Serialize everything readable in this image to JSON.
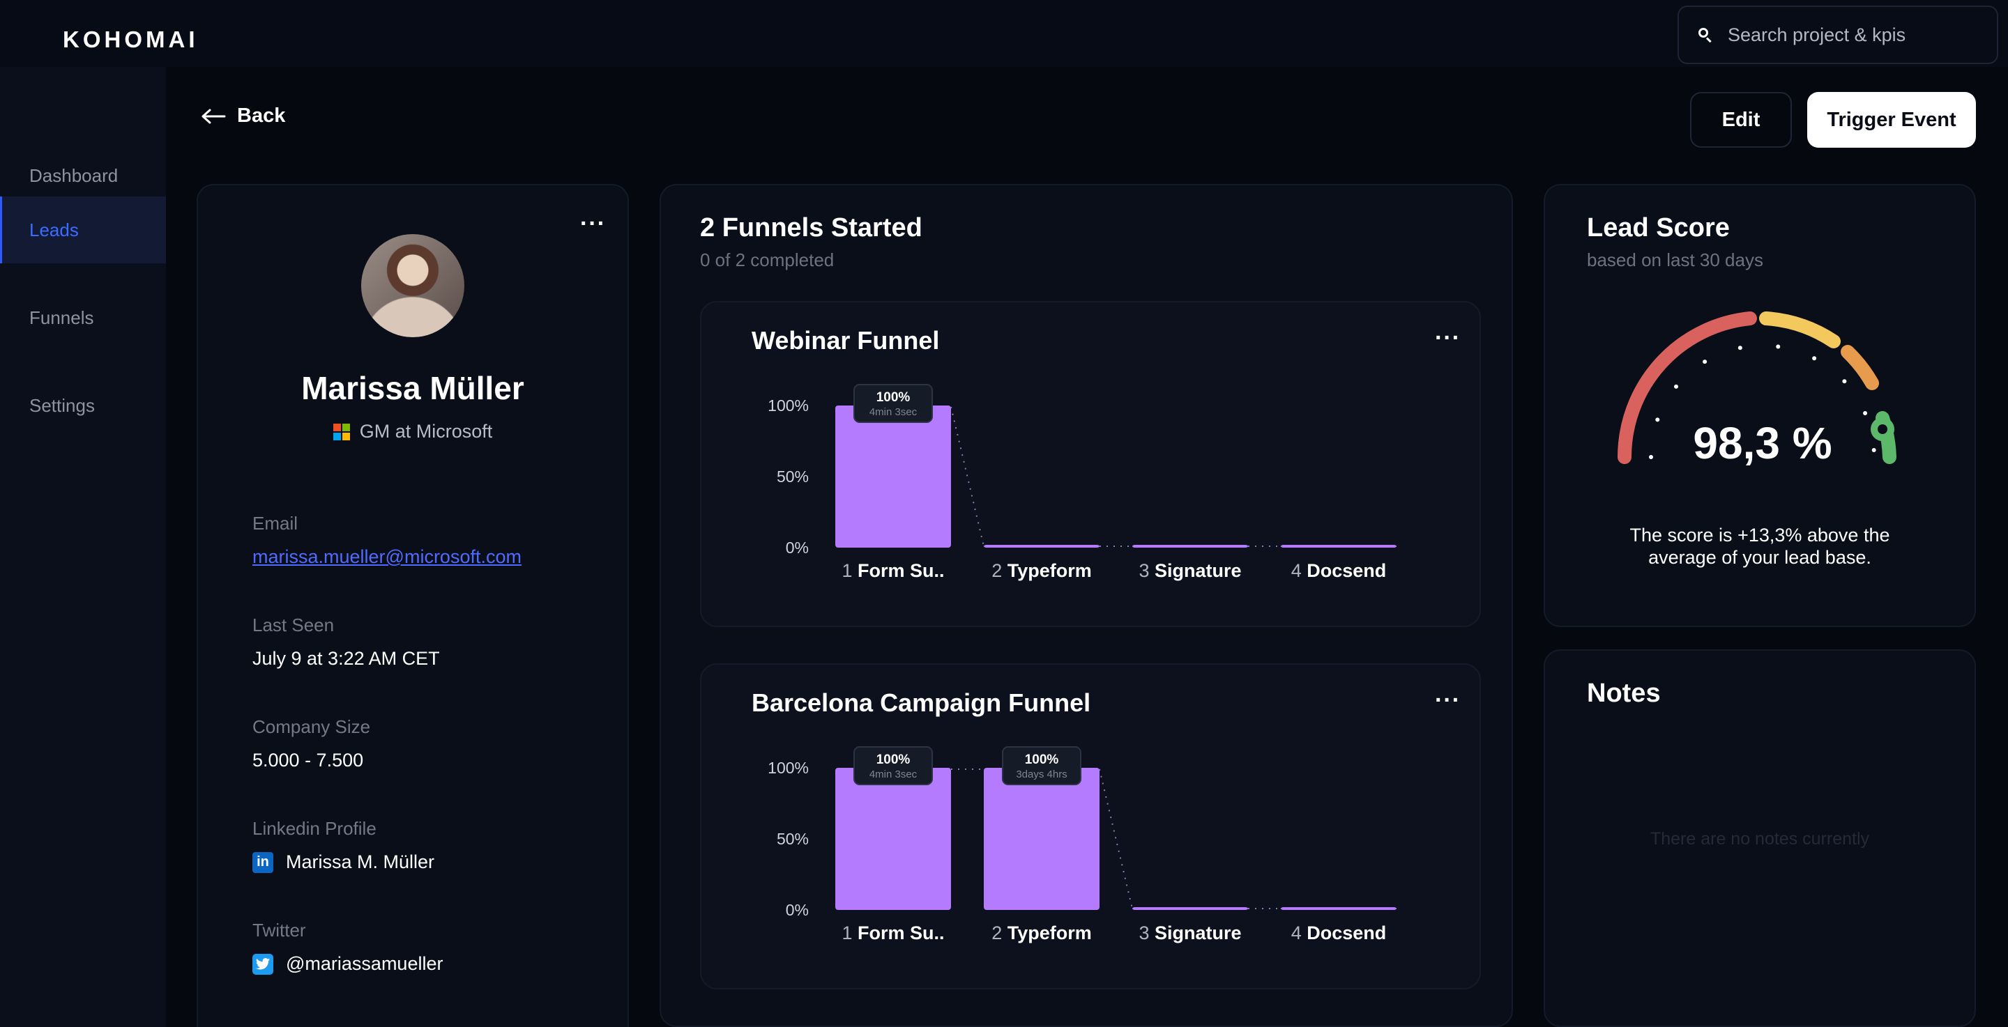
{
  "app": {
    "logo": "KOHOMAI"
  },
  "search": {
    "placeholder": "Search project & kpis",
    "icon": "search-icon"
  },
  "sidebar": {
    "items": [
      {
        "label": "Dashboard",
        "active": false
      },
      {
        "label": "Leads",
        "active": true
      },
      {
        "label": "Funnels",
        "active": false
      },
      {
        "label": "Settings",
        "active": false
      }
    ]
  },
  "header": {
    "back_label": "Back",
    "edit_label": "Edit",
    "trigger_label": "Trigger Event"
  },
  "profile": {
    "name": "Marissa Müller",
    "role": "GM at Microsoft",
    "fields": {
      "email_label": "Email",
      "email": "marissa.mueller@microsoft.com",
      "last_seen_label": "Last Seen",
      "last_seen": "July 9 at 3:22 AM CET",
      "company_size_label": "Company Size",
      "company_size": "5.000 - 7.500",
      "linkedin_label": "Linkedin Profile",
      "linkedin": "Marissa M. Müller",
      "twitter_label": "Twitter",
      "twitter": "@mariassamueller"
    }
  },
  "funnels": {
    "title": "2 Funnels Started",
    "subtitle": "0 of 2 completed"
  },
  "chart_data": [
    {
      "type": "bar",
      "title": "Webinar Funnel",
      "categories": [
        "Form Su..",
        "Typeform",
        "Signature",
        "Docsend"
      ],
      "category_numbers": [
        "1",
        "2",
        "3",
        "4"
      ],
      "values": [
        100,
        0,
        0,
        0
      ],
      "yticks": [
        "100%",
        "50%",
        "0%"
      ],
      "ylim": [
        0,
        100
      ],
      "labels": [
        {
          "index": 0,
          "value": "100%",
          "time": "4min 3sec"
        }
      ],
      "bar_color": "#b57bff"
    },
    {
      "type": "bar",
      "title": "Barcelona Campaign Funnel",
      "categories": [
        "Form Su..",
        "Typeform",
        "Signature",
        "Docsend"
      ],
      "category_numbers": [
        "1",
        "2",
        "3",
        "4"
      ],
      "values": [
        100,
        100,
        0,
        0
      ],
      "yticks": [
        "100%",
        "50%",
        "0%"
      ],
      "ylim": [
        0,
        100
      ],
      "labels": [
        {
          "index": 0,
          "value": "100%",
          "time": "4min 3sec"
        },
        {
          "index": 1,
          "value": "100%",
          "time": "3days 4hrs"
        }
      ],
      "bar_color": "#b57bff"
    }
  ],
  "lead_score": {
    "title": "Lead Score",
    "subtitle": "based on last 30 days",
    "value_text": "98,3 %",
    "value": 98.3,
    "description_line1": "The score is +13,3% above the",
    "description_line2": "average of your lead base.",
    "gauge_colors": [
      "#d9625f",
      "#f3c85c",
      "#e79b4d",
      "#5cb96a"
    ]
  },
  "notes": {
    "title": "Notes",
    "empty_text": "There are no notes currently"
  },
  "colors": {
    "accent": "#3b6cff",
    "bar": "#b57bff",
    "background": "#05080f"
  }
}
